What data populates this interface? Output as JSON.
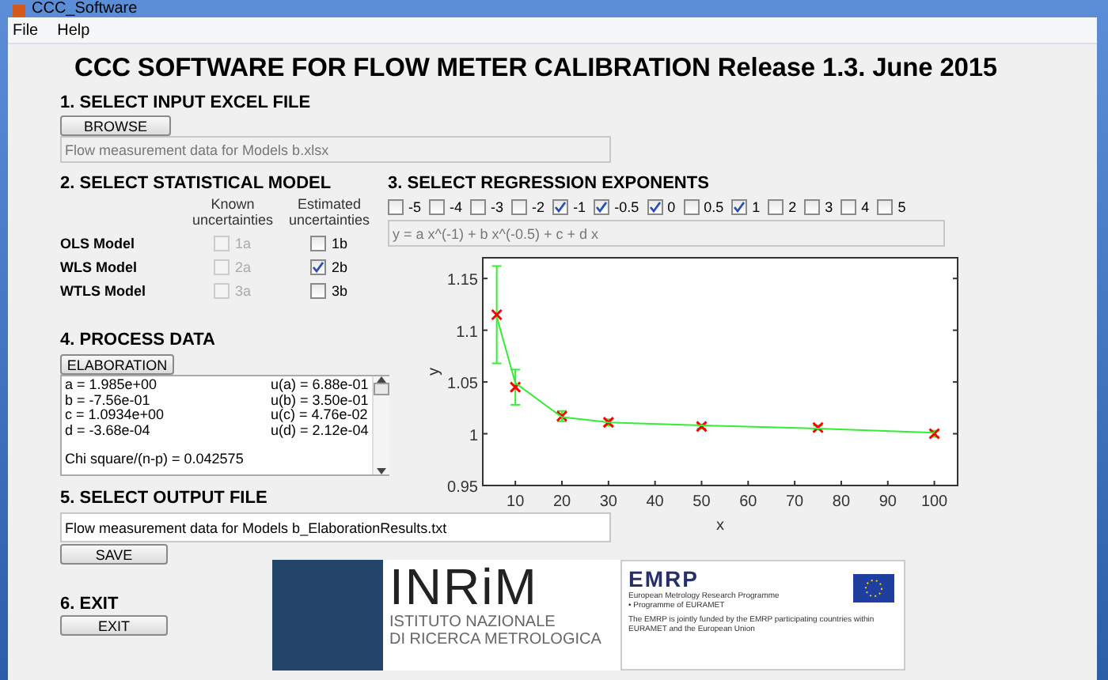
{
  "window": {
    "title": "CCC_Software"
  },
  "menu": [
    "File",
    "Help"
  ],
  "title": "CCC SOFTWARE FOR FLOW METER CALIBRATION Release 1.3. June 2015",
  "input_section": {
    "heading": "1. SELECT INPUT EXCEL FILE",
    "button": "BROWSE",
    "file": "Flow measurement data for Models b.xlsx"
  },
  "model_section": {
    "heading": "2. SELECT STATISTICAL MODEL",
    "column_headers": [
      "Known uncertainties",
      "Estimated uncertainties"
    ],
    "models": [
      {
        "label": "OLS Model",
        "known": {
          "label": "1a",
          "checked": false,
          "disabled": true
        },
        "estimated": {
          "label": "1b",
          "checked": false,
          "disabled": false
        }
      },
      {
        "label": "WLS Model",
        "known": {
          "label": "2a",
          "checked": false,
          "disabled": true
        },
        "estimated": {
          "label": "2b",
          "checked": true,
          "disabled": false
        }
      },
      {
        "label": "WTLS Model",
        "known": {
          "label": "3a",
          "checked": false,
          "disabled": true
        },
        "estimated": {
          "label": "3b",
          "checked": false,
          "disabled": false
        }
      }
    ]
  },
  "exponent_section": {
    "heading": "3. SELECT REGRESSION EXPONENTS",
    "exponents": [
      {
        "label": "-5",
        "checked": false
      },
      {
        "label": "-4",
        "checked": false
      },
      {
        "label": "-3",
        "checked": false
      },
      {
        "label": "-2",
        "checked": false
      },
      {
        "label": "-1",
        "checked": true
      },
      {
        "label": "-0.5",
        "checked": true
      },
      {
        "label": "0",
        "checked": true
      },
      {
        "label": "0.5",
        "checked": false
      },
      {
        "label": "1",
        "checked": true
      },
      {
        "label": "2",
        "checked": false
      },
      {
        "label": "3",
        "checked": false
      },
      {
        "label": "4",
        "checked": false
      },
      {
        "label": "5",
        "checked": false
      }
    ],
    "formula": "y = a x^(-1) + b x^(-0.5) + c  + d x"
  },
  "process_section": {
    "heading": "4. PROCESS DATA",
    "button": "ELABORATION",
    "results": [
      {
        "value": "a = 1.985e+00",
        "uncertainty": "u(a) = 6.88e-01"
      },
      {
        "value": "b = -7.56e-01",
        "uncertainty": "u(b) = 3.50e-01"
      },
      {
        "value": "c = 1.0934e+00",
        "uncertainty": "u(c) = 4.76e-02"
      },
      {
        "value": "d = -3.68e-04",
        "uncertainty": "u(d) = 2.12e-04"
      }
    ],
    "chi_square": "Chi square/(n-p) = 0.042575"
  },
  "plot": {
    "chart_data": {
      "type": "scatter",
      "xlabel": "x",
      "ylabel": "y",
      "x": [
        6,
        10,
        20,
        30,
        50,
        75,
        100
      ],
      "series": [
        {
          "type": "scatter",
          "color": "#ff0000",
          "values": [
            1.115,
            1.045,
            1.017,
            1.011,
            1.007,
            1.006,
            1.0
          ],
          "errors": [
            0.047,
            0.017,
            0.005,
            0.003,
            0.002,
            0.002,
            0.003
          ]
        },
        {
          "type": "line",
          "color": "#33ee33",
          "values": [
            1.113,
            1.049,
            1.016,
            1.011,
            1.008,
            1.005,
            1.001
          ]
        }
      ],
      "xlim": [
        3,
        105
      ],
      "ylim": [
        0.95,
        1.17
      ],
      "xticks": [
        10,
        20,
        30,
        40,
        50,
        60,
        70,
        80,
        90,
        100
      ],
      "yticks": [
        {
          "value": 0.95,
          "label": "0.95"
        },
        {
          "value": 1,
          "label": "1"
        },
        {
          "value": 1.05,
          "label": "1.05"
        },
        {
          "value": 1.1,
          "label": "1.1"
        },
        {
          "value": 1.15,
          "label": "1.15"
        }
      ]
    }
  },
  "output_section": {
    "heading": "5. SELECT OUTPUT FILE",
    "file": "Flow measurement data for Models b_ElaborationResults.txt",
    "button": "SAVE"
  },
  "exit_section": {
    "heading": "6. EXIT",
    "button": "EXIT"
  },
  "logos": {
    "inrim": {
      "name": "INRiM",
      "lines": [
        "ISTITUTO NAZIONALE",
        "DI RICERCA METROLOGICA"
      ]
    },
    "emrp": {
      "name": "EMRP",
      "subtitle": "European Metrology Research Programme",
      "programme": "• Programme of EURAMET",
      "note": "The EMRP is jointly funded by the EMRP participating countries within EURAMET and the European Union"
    }
  }
}
